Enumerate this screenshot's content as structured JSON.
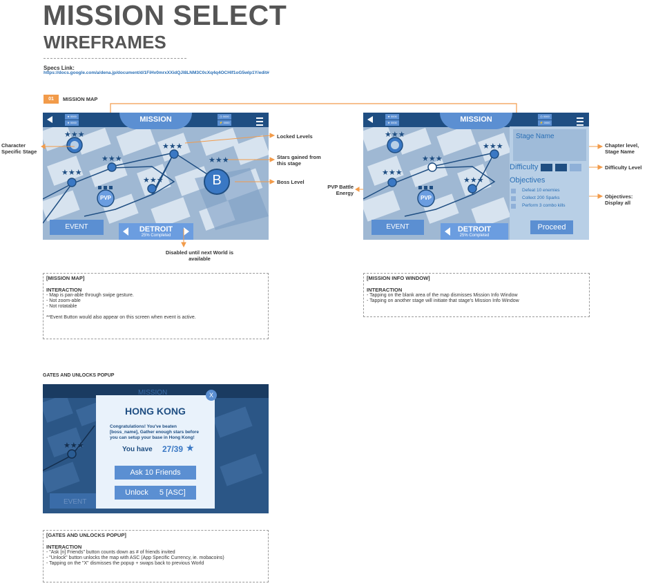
{
  "header": {
    "title": "MISSION SELECT",
    "subtitle": "WIREFRAMES",
    "specs_label": "Specs Link:",
    "specs_url": "https://docs.google.com/a/dena.jp/document/d/1FiHv0mrxXXidQJl8LNM3C0cXq4q4OCHIf1oG5wlp1Y/edit#"
  },
  "section1": {
    "number": "01",
    "title": "MISSION MAP"
  },
  "screen": {
    "mission_label": "MISSION",
    "res1": "★ 0000",
    "res2": "★ 0000",
    "res3": "◷ 0000",
    "res4": "⚡ 0000",
    "event_label": "EVENT",
    "world_name": "DETROIT",
    "world_progress": "25% Completed",
    "pvp_label": "PVP",
    "boss_label": "B"
  },
  "info_window": {
    "stage_name": "Stage Name",
    "difficulty_label": "Difficulty",
    "objectives_label": "Objectives",
    "objectives": [
      "Defeat 10 enemies",
      "Collect 200 Sparks",
      "Perform 3 combo kills"
    ],
    "proceed_label": "Proceed"
  },
  "annotations": {
    "character_stage": "Character Specific Stage",
    "locked_levels": "Locked Levels",
    "stars_gained": "Stars gained from this stage",
    "boss_level": "Boss Level",
    "disabled_note": "Disabled until next World is available",
    "pvp_energy": "PVP Battle Energy",
    "chapter_level": "Chapter level, Stage Name",
    "difficulty_level": "Difficulty Level",
    "objectives_display": "Objectives: Display all"
  },
  "notes": {
    "map": {
      "title": "[MISSION MAP]",
      "interaction": "INTERACTION",
      "lines": [
        "- Map is pan-able through swipe gesture.",
        "- Not zoom-able",
        "- Not rotatable"
      ],
      "footnote": "**Event Button would also appear on this screen when event is active."
    },
    "info": {
      "title": "[MISSION INFO WINDOW]",
      "interaction": "INTERACTION",
      "lines": [
        "- Tapping on the blank area of the map dismisses Mission Info Window",
        "- Tapping on another stage will initiate that stage's Mission Info Window"
      ]
    },
    "gates": {
      "title": "[GATES AND UNLOCKS POPUP]",
      "interaction": "INTERACTION",
      "lines": [
        "- \"Ask [n] Friends\" button counts down as # of friends invited",
        "- \"Unlock\" button unlocks the map with ASC (App Specific Currency, ie. mobacoins)",
        "- Tapping on the \"X\" dismisses the popup + swaps back to previous World"
      ]
    }
  },
  "gates_section_title": "GATES AND UNLOCKS POPUP",
  "popup": {
    "close_label": "X",
    "city": "HONG KONG",
    "message": "Congratulations! You've beaten [boss_name], Gather enough stars before you can setup your base in Hong Kong!",
    "you_have": "You have",
    "stars": "27/39",
    "ask_label": "Ask 10 Friends",
    "unlock_label": "Unlock",
    "unlock_cost": "5 [ASC]"
  },
  "colors": {
    "topbar": "#1f4e82",
    "accent": "#5b8fd2",
    "node": "#3a78c4",
    "annotation_line": "#f29b4a",
    "map_bg": "#9fb8d3"
  }
}
